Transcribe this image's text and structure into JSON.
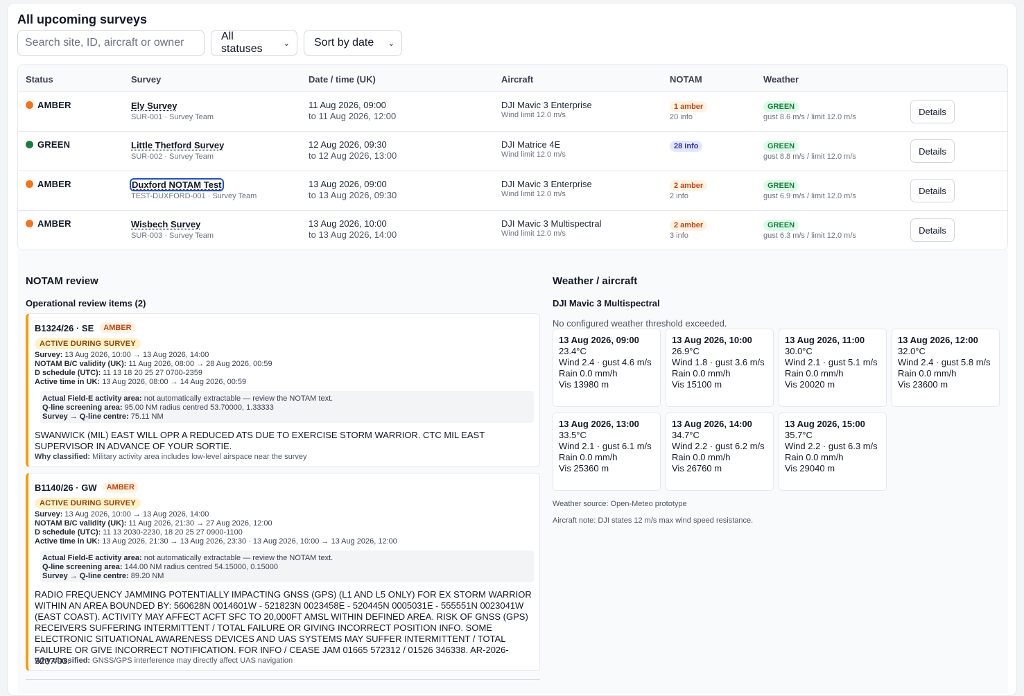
{
  "page": {
    "title": "All upcoming surveys"
  },
  "filters": {
    "search_placeholder": "Search site, ID, aircraft or owner",
    "status_selected": "All statuses",
    "sort_selected": "Sort by date"
  },
  "table": {
    "headers": [
      "Status",
      "Survey",
      "Date / time (UK)",
      "Aircraft",
      "NOTAM",
      "Weather"
    ],
    "details_label": "Details",
    "rows": [
      {
        "status": "AMBER",
        "status_color": "#f97316",
        "name": "Ely Survey",
        "sub": "SUR-001 · Survey Team",
        "date_from": "11 Aug 2026, 09:00",
        "date_to": "to 11 Aug 2026, 12:00",
        "aircraft": "DJI Mavic 3 Enterprise",
        "wind_limit": "Wind limit 12.0 m/s",
        "notam_pill": "1 amber",
        "notam_info": "20 info",
        "wx_pill": "GREEN",
        "wx_detail": "gust 8.6 m/s / limit 12.0 m/s"
      },
      {
        "status": "GREEN",
        "status_color": "#15803d",
        "name": "Little Thetford Survey",
        "sub": "SUR-002 · Survey Team",
        "date_from": "12 Aug 2026, 09:30",
        "date_to": "to 12 Aug 2026, 13:00",
        "aircraft": "DJI Matrice 4E",
        "wind_limit": "Wind limit 12.0 m/s",
        "notam_pill": "28 info",
        "notam_info": "",
        "wx_pill": "GREEN",
        "wx_detail": "gust 8.8 m/s / limit 12.0 m/s"
      },
      {
        "status": "AMBER",
        "status_color": "#f97316",
        "name": "Duxford NOTAM Test",
        "sub": "TEST-DUXFORD-001 · Survey Team",
        "date_from": "13 Aug 2026, 09:00",
        "date_to": "to 13 Aug 2026, 09:30",
        "aircraft": "DJI Mavic 3 Enterprise",
        "wind_limit": "Wind limit 12.0 m/s",
        "notam_pill": "2 amber",
        "notam_info": "2 info",
        "wx_pill": "GREEN",
        "wx_detail": "gust 6.9 m/s / limit 12.0 m/s"
      },
      {
        "status": "AMBER",
        "status_color": "#f97316",
        "name": "Wisbech Survey",
        "sub": "SUR-003 · Survey Team",
        "date_from": "13 Aug 2026, 10:00",
        "date_to": "to 13 Aug 2026, 14:00",
        "aircraft": "DJI Mavic 3 Multispectral",
        "wind_limit": "Wind limit 12.0 m/s",
        "notam_pill": "2 amber",
        "notam_info": "3 info",
        "wx_pill": "GREEN",
        "wx_detail": "gust 6.3 m/s / limit 12.0 m/s"
      }
    ]
  },
  "notam_review": {
    "title": "NOTAM review",
    "items_heading": "Operational review items (2)",
    "items": [
      {
        "id": "B1324/26 · SE",
        "level": "AMBER",
        "active": "ACTIVE DURING SURVEY",
        "lines": [
          {
            "k": "Survey:",
            "v": " 13 Aug 2026, 10:00 → 13 Aug 2026, 14:00"
          },
          {
            "k": "NOTAM B/C validity (UK):",
            "v": " 11 Aug 2026, 08:00 → 28 Aug 2026, 00:59"
          },
          {
            "k": "D schedule (UTC):",
            "v": " 11 13 18 20 25 27 0700-2359"
          },
          {
            "k": "Active time in UK:",
            "v": " 13 Aug 2026, 08:00 → 14 Aug 2026, 00:59"
          }
        ],
        "box": [
          {
            "k": "Actual Field-E activity area:",
            "v": " not automatically extractable — review the NOTAM text."
          },
          {
            "k": "Q-line screening area:",
            "v": " 95.00 NM radius centred 53.70000, 1.33333"
          },
          {
            "k": "Survey → Q-line centre:",
            "v": " 75.11 NM"
          }
        ],
        "text": "SWANWICK (MIL) EAST WILL OPR A REDUCED ATS DUE TO EXERCISE STORM WARRIOR. CTC MIL EAST SUPERVISOR IN ADVANCE OF YOUR SORTIE.",
        "why_k": "Why classified:",
        "why_v": " Military activity area includes low-level airspace near the survey"
      },
      {
        "id": "B1140/26 · GW",
        "level": "AMBER",
        "active": "ACTIVE DURING SURVEY",
        "lines": [
          {
            "k": "Survey:",
            "v": " 13 Aug 2026, 10:00 → 13 Aug 2026, 14:00"
          },
          {
            "k": "NOTAM B/C validity (UK):",
            "v": " 11 Aug 2026, 21:30 → 27 Aug 2026, 12:00"
          },
          {
            "k": "D schedule (UTC):",
            "v": " 11 13 2030-2230, 18 20 25 27 0900-1100"
          },
          {
            "k": "Active time in UK:",
            "v": " 13 Aug 2026, 21:30 → 13 Aug 2026, 23:30 · 13 Aug 2026, 10:00 → 13 Aug 2026, 12:00"
          }
        ],
        "box": [
          {
            "k": "Actual Field-E activity area:",
            "v": " not automatically extractable — review the NOTAM text."
          },
          {
            "k": "Q-line screening area:",
            "v": " 144.00 NM radius centred 54.15000, 0.15000"
          },
          {
            "k": "Survey → Q-line centre:",
            "v": " 89.20 NM"
          }
        ],
        "text": "RADIO FREQUENCY JAMMING POTENTIALLY IMPACTING GNSS (GPS) (L1 AND L5 ONLY) FOR EX STORM WARRIOR WITHIN AN AREA BOUNDED BY: 560628N 0014601W - 521823N 0023458E - 520445N 0005031E - 555551N 0023041W (EAST COAST). ACTIVITY MAY AFFECT ACFT SFC TO 20,000FT AMSL WITHIN DEFINED AREA. RISK OF GNSS (GPS) RECEIVERS SUFFERING INTERMITTENT / TOTAL FAILURE OR GIVING INCORRECT POSITION INFO. SOME ELECTRONIC SITUATIONAL AWARENESS DEVICES AND UAS SYSTEMS MAY SUFFER INTERMITTENT / TOTAL FAILURE OR GIVE INCORRECT NOTIFICATION. FOR INFO / CEASE JAM 01665 572312 / 01526 346338. AR-2026-3237/03.",
        "why_k": "Why classified:",
        "why_v": " GNSS/GPS interference may directly affect UAS navigation"
      }
    ]
  },
  "weather": {
    "title": "Weather / aircraft",
    "aircraft": "DJI Mavic 3 Multispectral",
    "status_text": "No configured weather threshold exceeded.",
    "cards": [
      {
        "time": "13 Aug 2026, 09:00",
        "temp": "23.4°C",
        "wind": "Wind 2.4 · gust 4.6 m/s",
        "rain": "Rain 0.0 mm/h",
        "vis": "Vis 13980 m"
      },
      {
        "time": "13 Aug 2026, 10:00",
        "temp": "26.9°C",
        "wind": "Wind 1.8 · gust 3.6 m/s",
        "rain": "Rain 0.0 mm/h",
        "vis": "Vis 15100 m"
      },
      {
        "time": "13 Aug 2026, 11:00",
        "temp": "30.0°C",
        "wind": "Wind 2.1 · gust 5.1 m/s",
        "rain": "Rain 0.0 mm/h",
        "vis": "Vis 20020 m"
      },
      {
        "time": "13 Aug 2026, 12:00",
        "temp": "32.0°C",
        "wind": "Wind 2.4 · gust 5.8 m/s",
        "rain": "Rain 0.0 mm/h",
        "vis": "Vis 23600 m"
      },
      {
        "time": "13 Aug 2026, 13:00",
        "temp": "33.5°C",
        "wind": "Wind 2.1 · gust 6.1 m/s",
        "rain": "Rain 0.0 mm/h",
        "vis": "Vis 25360 m"
      },
      {
        "time": "13 Aug 2026, 14:00",
        "temp": "34.7°C",
        "wind": "Wind 2.2 · gust 6.2 m/s",
        "rain": "Rain 0.0 mm/h",
        "vis": "Vis 26760 m"
      },
      {
        "time": "13 Aug 2026, 15:00",
        "temp": "35.7°C",
        "wind": "Wind 2.2 · gust 6.3 m/s",
        "rain": "Rain 0.0 mm/h",
        "vis": "Vis 29040 m"
      }
    ],
    "source": "Weather source: Open-Meteo prototype",
    "aircraft_note": "Aircraft note: DJI states 12 m/s max wind speed resistance."
  }
}
